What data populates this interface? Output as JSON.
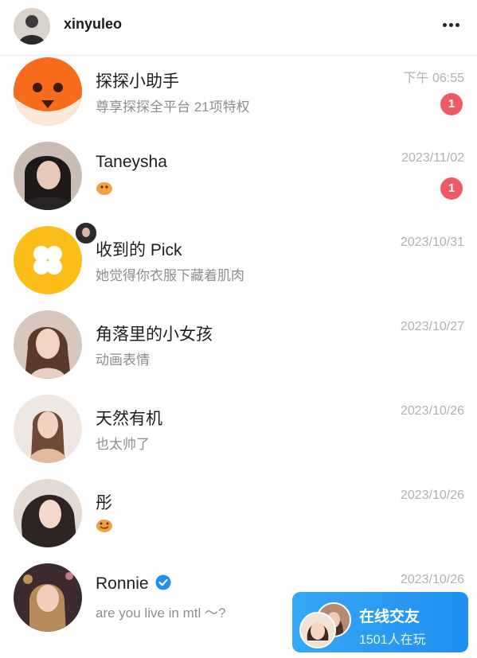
{
  "header": {
    "username": "xinyuleo",
    "more_label": "•••"
  },
  "conversations": [
    {
      "name": "探探小助手",
      "preview": "尊享探探全平台 21项特权",
      "time": "下午 06:55",
      "unread": "1"
    },
    {
      "name": "Taneysha",
      "preview": "",
      "time": "2023/11/02",
      "unread": "1"
    },
    {
      "name": "收到的 Pick",
      "preview": "她觉得你衣服下藏着肌肉",
      "time": "2023/10/31",
      "unread": ""
    },
    {
      "name": "角落里的小女孩",
      "preview": "动画表情",
      "time": "2023/10/27",
      "unread": ""
    },
    {
      "name": "天然有机",
      "preview": "也太帅了",
      "time": "2023/10/26",
      "unread": ""
    },
    {
      "name": "彤",
      "preview": "",
      "time": "2023/10/26",
      "unread": ""
    },
    {
      "name": "Ronnie",
      "preview": "are you live in mtl ～?",
      "time": "2023/10/26",
      "unread": ""
    }
  ],
  "floating_card": {
    "title": "在线交友",
    "subtitle": "1501人在玩"
  },
  "colors": {
    "badge": "#ec5a63",
    "brand_orange": "#f76b1c",
    "pick_yellow": "#fbbe18",
    "verified_blue": "#1f8ff0",
    "card_blue": "#2a9bf3"
  }
}
